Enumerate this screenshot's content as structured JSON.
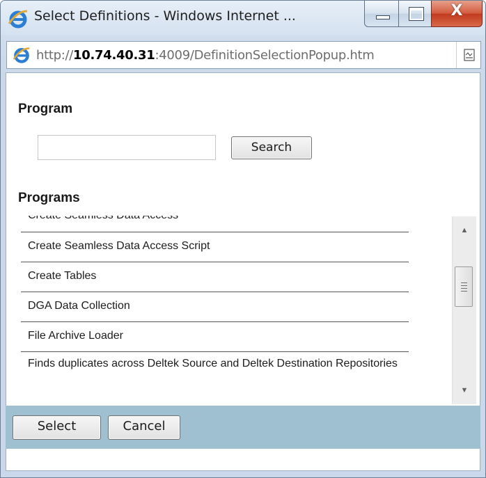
{
  "window": {
    "title": "Select Definitions - Windows Internet ...",
    "close_glyph": "X",
    "minimize_icon": "minimize-icon",
    "maximize_icon": "maximize-icon",
    "close_icon": "close-icon"
  },
  "address": {
    "scheme": "http://",
    "host": "10.74.40.31",
    "rest": ":4009/DefinitionSelectionPopup.htm",
    "browser_icon": "ie-logo-icon",
    "page_icon": "page-broken-icon"
  },
  "program": {
    "title": "Program",
    "search_value": "",
    "search_label": "Search"
  },
  "programs": {
    "title": "Programs",
    "items": [
      "Create Seamless Data Access",
      "Create Seamless Data Access Script",
      "Create Tables",
      "DGA Data Collection",
      "File Archive Loader",
      "Finds duplicates across Deltek Source and Deltek Destination Repositories"
    ],
    "scroll_up_glyph": "▲",
    "scroll_down_glyph": "▼"
  },
  "footer": {
    "select_label": "Select",
    "cancel_label": "Cancel"
  },
  "colors": {
    "footer_band": "#9ec0d0",
    "close_button": "#c23a1e",
    "address_host": "#000000"
  }
}
